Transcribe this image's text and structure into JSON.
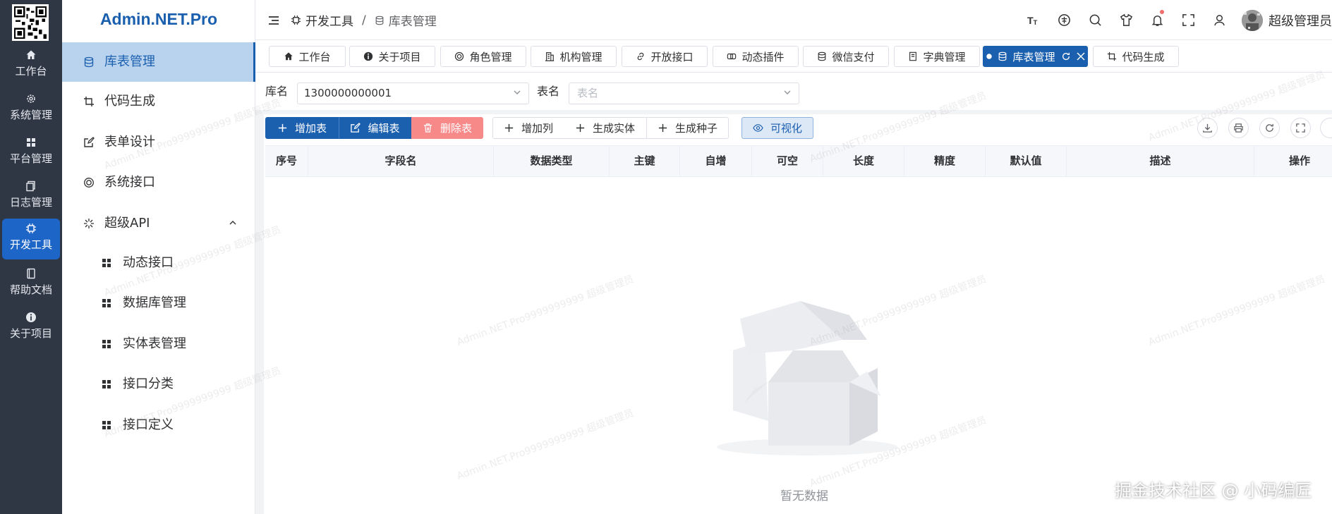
{
  "app": {
    "logo_text": "Admin.NET.Pro"
  },
  "rail": [
    {
      "label": "工作台",
      "icon": "home-icon"
    },
    {
      "label": "系统管理",
      "icon": "gear-icon"
    },
    {
      "label": "平台管理",
      "icon": "grid-icon"
    },
    {
      "label": "日志管理",
      "icon": "copy-icon"
    },
    {
      "label": "开发工具",
      "icon": "cpu-icon",
      "active": true
    },
    {
      "label": "帮助文档",
      "icon": "book-icon"
    },
    {
      "label": "关于项目",
      "icon": "info-icon"
    }
  ],
  "menu": {
    "items": [
      {
        "label": "库表管理",
        "icon": "database-icon",
        "active": true
      },
      {
        "label": "代码生成",
        "icon": "crop-icon"
      },
      {
        "label": "表单设计",
        "icon": "edit-icon"
      },
      {
        "label": "系统接口",
        "icon": "target-icon"
      },
      {
        "label": "超级API",
        "icon": "spark-icon",
        "expanded": true
      }
    ],
    "subitems": [
      {
        "label": "动态接口",
        "icon": "grid-icon"
      },
      {
        "label": "数据库管理",
        "icon": "grid-icon"
      },
      {
        "label": "实体表管理",
        "icon": "grid-icon"
      },
      {
        "label": "接口分类",
        "icon": "grid-icon"
      },
      {
        "label": "接口定义",
        "icon": "grid-icon"
      }
    ]
  },
  "header": {
    "breadcrumb": [
      "开发工具",
      "库表管理"
    ],
    "breadcrumb_sep": "/",
    "user_name": "超级管理员",
    "tools": [
      "font-size-icon",
      "translate-icon",
      "search-icon",
      "theme-shirt-icon",
      "bell-icon",
      "fullscreen-icon",
      "user-icon"
    ]
  },
  "tabs": [
    {
      "label": "工作台",
      "icon": "home-icon"
    },
    {
      "label": "关于项目",
      "icon": "info-icon"
    },
    {
      "label": "角色管理",
      "icon": "target-icon"
    },
    {
      "label": "机构管理",
      "icon": "building-icon"
    },
    {
      "label": "开放接口",
      "icon": "link-icon"
    },
    {
      "label": "动态插件",
      "icon": "plugin-icon"
    },
    {
      "label": "微信支付",
      "icon": "database-icon"
    },
    {
      "label": "字典管理",
      "icon": "dict-icon"
    },
    {
      "label": "库表管理",
      "icon": "database-icon",
      "active": true
    },
    {
      "label": "代码生成",
      "icon": "crop-icon"
    }
  ],
  "filter": {
    "db_label": "库名",
    "db_value": "1300000000001",
    "table_label": "表名",
    "table_placeholder": "表名"
  },
  "toolbar": {
    "add_table": "增加表",
    "edit_table": "编辑表",
    "delete_table": "删除表",
    "add_column": "增加列",
    "gen_entity": "生成实体",
    "gen_seed": "生成种子",
    "visualize": "可视化"
  },
  "table": {
    "columns": [
      "序号",
      "字段名",
      "数据类型",
      "主键",
      "自增",
      "可空",
      "长度",
      "精度",
      "默认值",
      "描述",
      "操作"
    ],
    "empty_text": "暂无数据"
  },
  "watermark": {
    "text": "Admin.NET.Pro9999999999 超级管理员",
    "brand": "掘金技术社区 @ 小码编匠"
  },
  "colors": {
    "primary": "#1b5faf",
    "rail_bg": "#2f3744",
    "danger": "#f78989",
    "menu_active_bg": "#b9d3ee"
  }
}
